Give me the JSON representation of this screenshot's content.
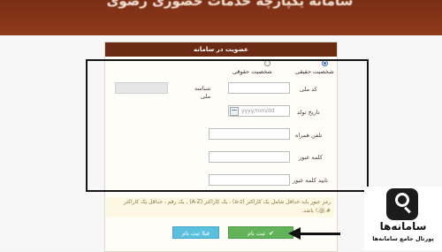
{
  "banner": {
    "title": "سامانه یکپارچه خدمات حضوری رضوی"
  },
  "panel": {
    "header": "عضویت در سامانه"
  },
  "person_type": {
    "options": [
      {
        "label": "شخصیت حقیقی",
        "checked": true
      },
      {
        "label": "شخصیت حقوقی",
        "checked": false
      }
    ]
  },
  "form": {
    "national_code_label": "کد ملی",
    "id_number_label_1": "شناسه",
    "id_number_label_2": "ملی",
    "birth_date_label": "تاریخ تولد",
    "birth_date_placeholder": "yyyy/mm/dd",
    "mobile_label": "تلفن همراه",
    "password_label": "کلمه عبور",
    "confirm_password_label": "تایید کلمه عبور"
  },
  "warning": {
    "text": "رمز عبور باید حداقل شامل یک کاراکتر (a-z) ، یک کاراکتر (A-Z) ، یک رقم ، حداقل یک کاراکتر #,@,! باشد."
  },
  "buttons": {
    "submit_label": "ثبت نام",
    "before_label": "قبلا ثبت نام"
  },
  "logo": {
    "title": "سامانه‌ها",
    "subtitle": "پورتال جامع سامانه‌ها"
  }
}
